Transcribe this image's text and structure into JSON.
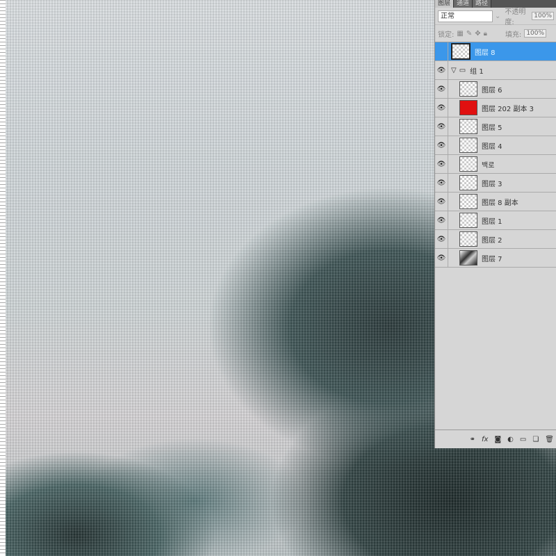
{
  "tabs": [
    "图层",
    "通道",
    "路径"
  ],
  "blend_mode": "正常",
  "opacity_label": "不透明度:",
  "opacity": "100%",
  "lock_label": "锁定:",
  "fill_label": "填充:",
  "fill": "100%",
  "layers": [
    {
      "name": "图层 8",
      "selected": true
    },
    {
      "name": "组 1",
      "group": true
    },
    {
      "name": "图层 6"
    },
    {
      "name": "图层 202 副本 3",
      "color": "#e01010"
    },
    {
      "name": "图层 5"
    },
    {
      "name": "图层 4"
    },
    {
      "name": "백로"
    },
    {
      "name": "图层 3"
    },
    {
      "name": "图层 8 副本"
    },
    {
      "name": "图层 1"
    },
    {
      "name": "图层 2"
    },
    {
      "name": "图层 7",
      "image": true
    }
  ],
  "footer_icons": [
    "link-icon",
    "fx-icon",
    "mask-icon",
    "adjustment-icon",
    "folder-icon",
    "new-layer-icon",
    "trash-icon"
  ]
}
